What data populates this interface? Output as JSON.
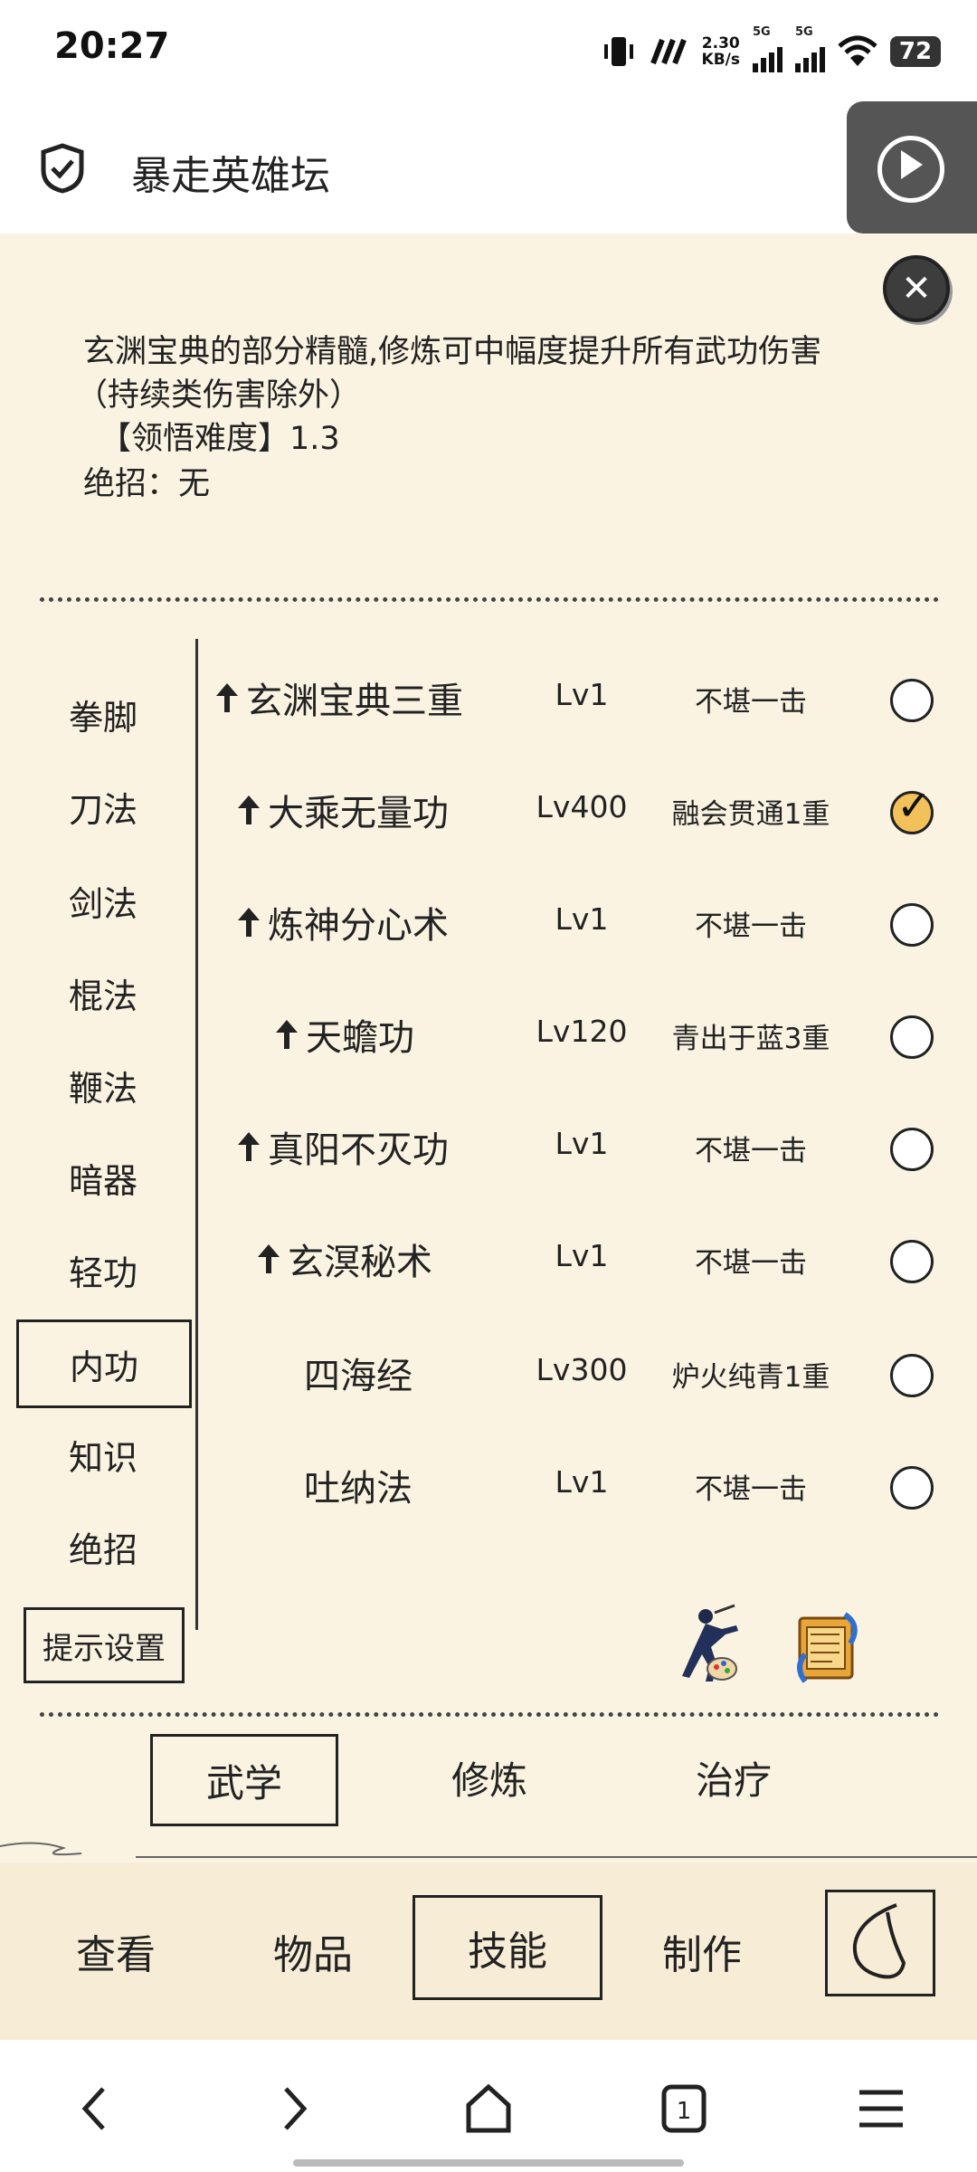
{
  "status_bar": {
    "time": "20:27",
    "net_speed_value": "2.30",
    "net_speed_unit": "KB/s",
    "signal1_label": "5G",
    "signal2_label": "5G",
    "battery": "72"
  },
  "header": {
    "title": "暴走英雄坛"
  },
  "description": {
    "line1": "玄渊宝典的部分精髓,修炼可中幅度提升所有武功伤害",
    "line2": "（持续类伤害除外）",
    "line3": "【领悟难度】1.3",
    "line4": "绝招：无"
  },
  "categories": [
    {
      "label": "拳脚"
    },
    {
      "label": "刀法"
    },
    {
      "label": "剑法"
    },
    {
      "label": "棍法"
    },
    {
      "label": "鞭法"
    },
    {
      "label": "暗器"
    },
    {
      "label": "轻功"
    },
    {
      "label": "内功",
      "selected": true
    },
    {
      "label": "知识"
    },
    {
      "label": "绝招"
    }
  ],
  "hint_settings_label": "提示设置",
  "skills": [
    {
      "name": "玄渊宝典三重",
      "level": "Lv1",
      "realm": "不堪一击",
      "upgradable": true,
      "checked": false
    },
    {
      "name": "大乘无量功",
      "level": "Lv400",
      "realm": "融会贯通1重",
      "upgradable": true,
      "checked": true
    },
    {
      "name": "炼神分心术",
      "level": "Lv1",
      "realm": "不堪一击",
      "upgradable": true,
      "checked": false
    },
    {
      "name": "天蟾功",
      "level": "Lv120",
      "realm": "青出于蓝3重",
      "upgradable": true,
      "checked": false
    },
    {
      "name": "真阳不灭功",
      "level": "Lv1",
      "realm": "不堪一击",
      "upgradable": true,
      "checked": false
    },
    {
      "name": "玄溟秘术",
      "level": "Lv1",
      "realm": "不堪一击",
      "upgradable": true,
      "checked": false
    },
    {
      "name": "四海经",
      "level": "Lv300",
      "realm": "炉火纯青1重",
      "upgradable": false,
      "checked": false
    },
    {
      "name": "吐纳法",
      "level": "Lv1",
      "realm": "不堪一击",
      "upgradable": false,
      "checked": false
    }
  ],
  "sub_tabs": [
    {
      "label": "武学",
      "selected": true
    },
    {
      "label": "修炼"
    },
    {
      "label": "治疗"
    }
  ],
  "bottom_tabs": [
    {
      "label": "查看"
    },
    {
      "label": "物品"
    },
    {
      "label": "技能",
      "selected": true
    },
    {
      "label": "制作"
    }
  ],
  "colors": {
    "panel_bg": "#fbf3e2",
    "checked_fill": "#f3c15a"
  }
}
